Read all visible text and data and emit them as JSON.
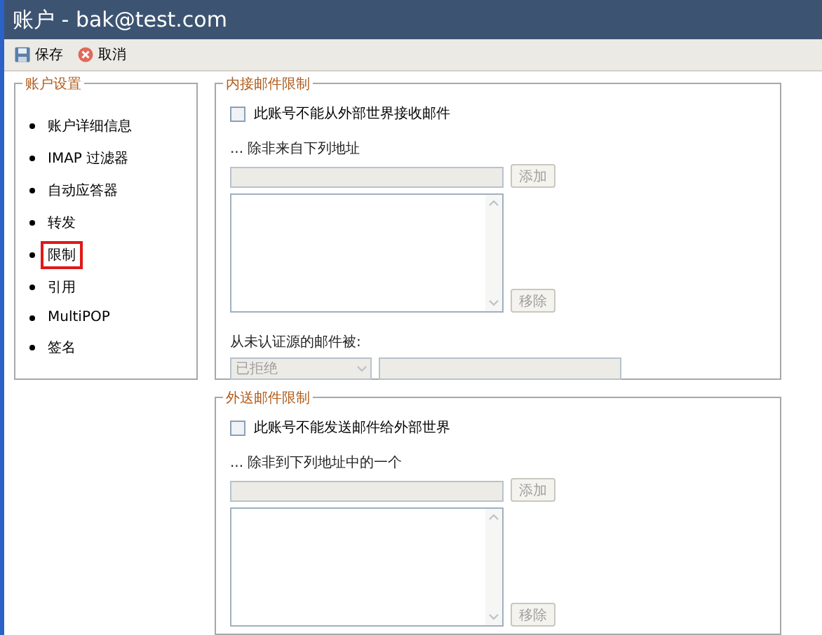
{
  "window": {
    "title": "账户 - bak@test.com"
  },
  "toolbar": [
    {
      "kind": "save",
      "label": "保存"
    },
    {
      "kind": "cancel",
      "label": "取消"
    }
  ],
  "sidebar": {
    "title": "账户设置",
    "items": [
      {
        "label": "账户详细信息",
        "selected": false
      },
      {
        "label": "IMAP 过滤器",
        "selected": false
      },
      {
        "label": "自动应答器",
        "selected": false
      },
      {
        "label": "转发",
        "selected": false
      },
      {
        "label": "限制",
        "selected": true
      },
      {
        "label": "引用",
        "selected": false
      },
      {
        "label": "MultiPOP",
        "selected": false
      },
      {
        "label": "签名",
        "selected": false
      }
    ]
  },
  "sections": [
    {
      "title": "内接邮件限制",
      "checkbox": {
        "label": "此账号不能从外部世界接收邮件",
        "checked": false
      },
      "caption": "... 除非来自下列地址",
      "add_button": {
        "label": "添加",
        "disabled": true
      },
      "remove_button": {
        "label": "移除",
        "disabled": true
      },
      "source": {
        "label": "从未认证源的邮件被:",
        "select": {
          "value": "已拒绝",
          "disabled": true
        }
      }
    },
    {
      "title": "外送邮件限制",
      "checkbox": {
        "label": "此账号不能发送邮件给外部世界",
        "checked": false
      },
      "caption": "... 除非到下列地址中的一个",
      "add_button": {
        "label": "添加",
        "disabled": true
      },
      "remove_button": {
        "label": "移除",
        "disabled": true
      }
    }
  ]
}
